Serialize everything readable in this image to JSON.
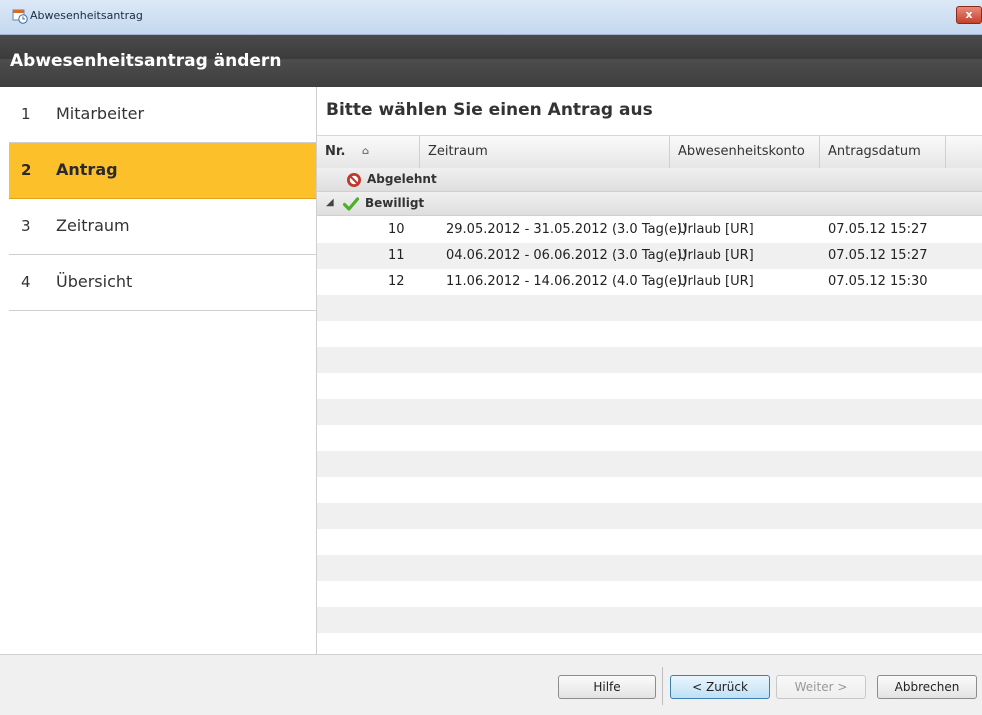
{
  "window": {
    "title": "Abwesenheitsantrag",
    "close_label": "x"
  },
  "header": {
    "title": "Abwesenheitsantrag ändern"
  },
  "sidebar": {
    "steps": [
      {
        "num": "1",
        "label": "Mitarbeiter"
      },
      {
        "num": "2",
        "label": "Antrag",
        "active": true
      },
      {
        "num": "3",
        "label": "Zeitraum"
      },
      {
        "num": "4",
        "label": "Übersicht"
      }
    ]
  },
  "main": {
    "heading": "Bitte wählen Sie einen Antrag aus",
    "columns": {
      "nr": "Nr.",
      "zeitraum": "Zeitraum",
      "konto": "Abwesenheitskonto",
      "datum": "Antragsdatum"
    },
    "groups": {
      "rejected": {
        "label": "Abgelehnt",
        "icon": "rejected-icon"
      },
      "approved": {
        "label": "Bewilligt",
        "icon": "checkmark-icon"
      }
    },
    "rows": [
      {
        "nr": "10",
        "zeitraum": "29.05.2012 - 31.05.2012 (3.0 Tag(e))",
        "konto": "Urlaub [UR]",
        "datum": "07.05.12 15:27"
      },
      {
        "nr": "11",
        "zeitraum": "04.06.2012 - 06.06.2012 (3.0 Tag(e))",
        "konto": "Urlaub [UR]",
        "datum": "07.05.12 15:27"
      },
      {
        "nr": "12",
        "zeitraum": "11.06.2012 - 14.06.2012 (4.0 Tag(e))",
        "konto": "Urlaub [UR]",
        "datum": "07.05.12 15:30"
      }
    ]
  },
  "footer": {
    "help": "Hilfe",
    "back": "< Zurück",
    "next": "Weiter >",
    "cancel": "Abbrechen"
  },
  "colors": {
    "accent": "#fcc02b",
    "header_bg": "#3c3c3c",
    "rejected": "#c0392b",
    "approved": "#4caf2a"
  }
}
